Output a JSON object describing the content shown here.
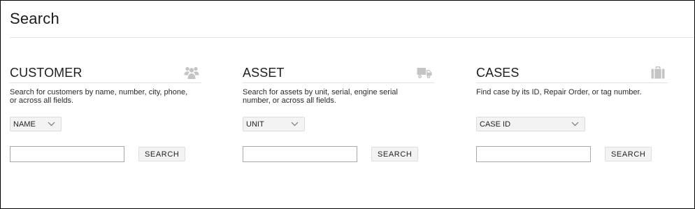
{
  "page": {
    "title": "Search"
  },
  "panels": [
    {
      "title": "CUSTOMER",
      "icon": "users-icon",
      "description": "Search for customers by name, number, city, phone, or across all fields.",
      "select": {
        "value": "NAME"
      },
      "input": {
        "value": "",
        "placeholder": ""
      },
      "button": "SEARCH"
    },
    {
      "title": "ASSET",
      "icon": "truck-icon",
      "description": "Search for assets by unit, serial, engine serial number, or across all fields.",
      "select": {
        "value": "UNIT"
      },
      "input": {
        "value": "",
        "placeholder": ""
      },
      "button": "SEARCH"
    },
    {
      "title": "CASES",
      "icon": "briefcase-icon",
      "description": "Find case by its ID, Repair Order, or tag number.",
      "select": {
        "value": "CASE ID"
      },
      "input": {
        "value": "",
        "placeholder": ""
      },
      "button": "SEARCH"
    }
  ],
  "colors": {
    "icon": "#c4c4c4",
    "border": "#000000",
    "button_bg": "#f3f3f3"
  }
}
